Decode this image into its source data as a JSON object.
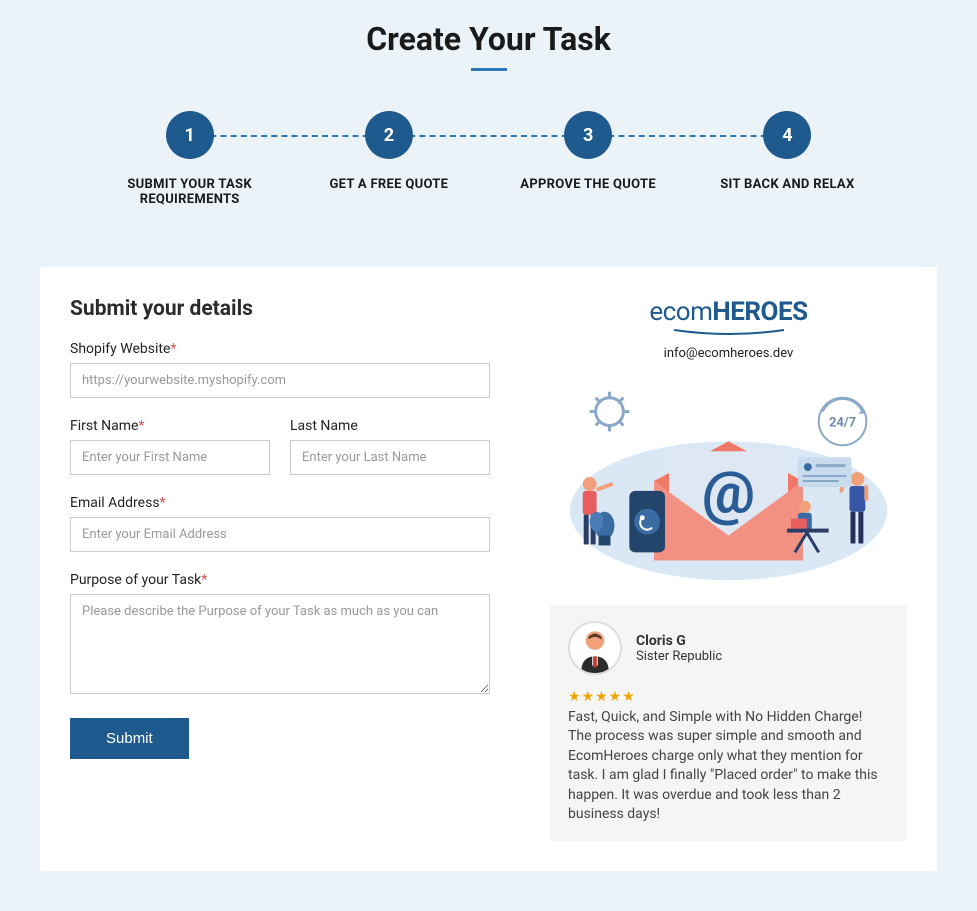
{
  "title": "Create Your Task",
  "steps": [
    {
      "num": "1",
      "label": "SUBMIT YOUR TASK REQUIREMENTS"
    },
    {
      "num": "2",
      "label": "GET A FREE QUOTE"
    },
    {
      "num": "3",
      "label": "APPROVE THE QUOTE"
    },
    {
      "num": "4",
      "label": "SIT BACK AND RELAX"
    }
  ],
  "form": {
    "heading": "Submit your details",
    "shopify_label": "Shopify Website",
    "shopify_placeholder": "https://yourwebsite.myshopify.com",
    "first_name_label": "First Name",
    "first_name_placeholder": "Enter your First Name",
    "last_name_label": "Last Name",
    "last_name_placeholder": "Enter your Last Name",
    "email_label": "Email Address",
    "email_placeholder": "Enter your Email Address",
    "purpose_label": "Purpose of your Task",
    "purpose_placeholder": "Please describe the Purpose of your Task as much as you can",
    "submit_label": "Submit",
    "required_mark": "*"
  },
  "brand": {
    "name_part1": "ecom",
    "name_part2": "Heroes",
    "email": "info@ecomheroes.dev"
  },
  "review": {
    "name": "Cloris G",
    "subtitle": "Sister Republic",
    "stars": "★★★★★",
    "title": "Fast, Quick, and Simple with No Hidden Charge!",
    "body": "The process was super simple and smooth and EcomHeroes charge only what they mention for task. I am glad I finally \"Placed order\" to make this happen. It was overdue and took less than 2 business days!"
  },
  "colors": {
    "primary": "#1e5a8e",
    "accent": "#2a78b8",
    "star": "#f0a500"
  }
}
